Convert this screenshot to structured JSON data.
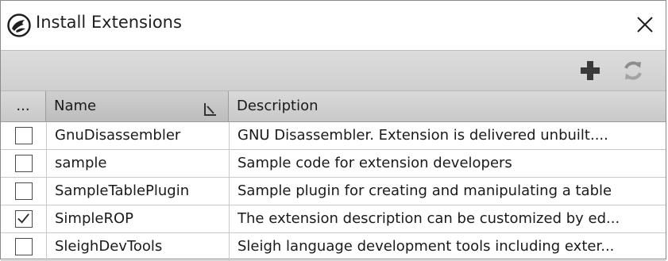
{
  "window": {
    "title": "Install Extensions",
    "app_icon": "ghidra-dragon-icon",
    "close_icon": "close-icon"
  },
  "toolbar": {
    "add_icon": "plus-icon",
    "refresh_icon": "refresh-icon"
  },
  "table": {
    "columns": [
      {
        "label": "..."
      },
      {
        "label": "Name"
      },
      {
        "label": "Description"
      }
    ],
    "rows": [
      {
        "checked": false,
        "name": "GnuDisassembler",
        "description": "GNU Disassembler.  Extension is delivered unbuilt...."
      },
      {
        "checked": false,
        "name": "sample",
        "description": "Sample code for extension developers"
      },
      {
        "checked": false,
        "name": "SampleTablePlugin",
        "description": "Sample plugin for creating and manipulating a table"
      },
      {
        "checked": true,
        "name": "SimpleROP",
        "description": "The extension description can be customized by ed..."
      },
      {
        "checked": false,
        "name": "SleighDevTools",
        "description": "Sleigh language development tools including exter..."
      }
    ]
  },
  "colors": {
    "toolbar_bg": "#d4d4d4",
    "header_bg": "#d0d0d0",
    "add_icon": "#3a3a3a"
  }
}
